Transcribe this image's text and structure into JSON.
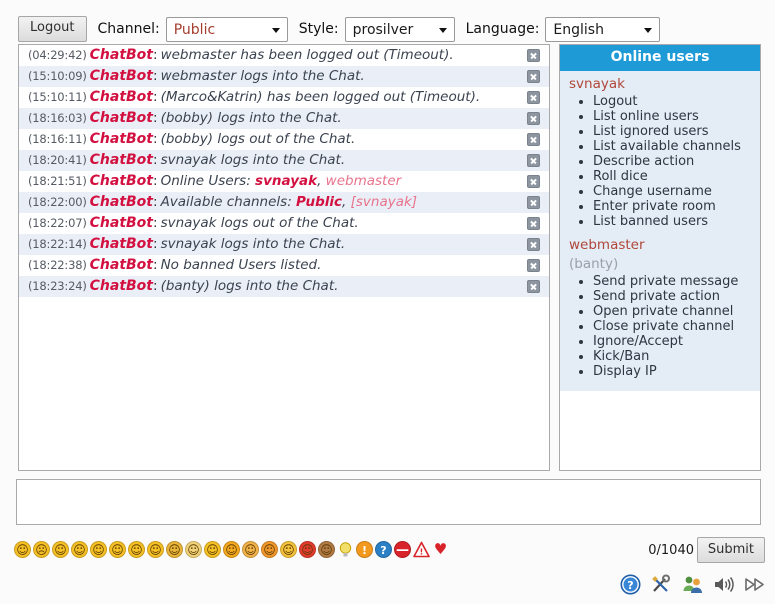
{
  "toolbar": {
    "logout_label": "Logout",
    "channel_label": "Channel:",
    "channel_value": "Public",
    "style_label": "Style:",
    "style_value": "prosilver",
    "language_label": "Language:",
    "language_value": "English"
  },
  "chat": {
    "messages": [
      {
        "time": "(04:29:42)",
        "nick": "ChatBot",
        "text": "webmaster has been logged out (Timeout).",
        "close": "close-icon"
      },
      {
        "time": "(15:10:09)",
        "nick": "ChatBot",
        "text": "webmaster logs into the Chat.",
        "close": "close-icon"
      },
      {
        "time": "(15:10:11)",
        "nick": "ChatBot",
        "text": "(Marco&Katrin) has been logged out (Timeout).",
        "close": "close-icon"
      },
      {
        "time": "(18:16:03)",
        "nick": "ChatBot",
        "text": "(bobby) logs into the Chat.",
        "close": "close-icon"
      },
      {
        "time": "(18:16:11)",
        "nick": "ChatBot",
        "text": "(bobby) logs out of the Chat.",
        "close": "close-icon"
      },
      {
        "time": "(18:20:41)",
        "nick": "ChatBot",
        "text": "svnayak logs into the Chat.",
        "close": "close-icon"
      },
      {
        "time": "(18:21:51)",
        "nick": "ChatBot",
        "text": "Online Users: svnayak, webmaster",
        "close": "close-icon",
        "rich": [
          {
            "t": "Online Users: ",
            "s": "plain"
          },
          {
            "t": "svnayak",
            "s": "hl"
          },
          {
            "t": ", ",
            "s": "plain"
          },
          {
            "t": "webmaster",
            "s": "soft"
          }
        ]
      },
      {
        "time": "(18:22:00)",
        "nick": "ChatBot",
        "text": "Available channels: Public, [svnayak]",
        "close": "close-icon",
        "rich": [
          {
            "t": "Available channels: ",
            "s": "plain"
          },
          {
            "t": "Public",
            "s": "hl"
          },
          {
            "t": ", ",
            "s": "plain"
          },
          {
            "t": "[svnayak]",
            "s": "soft"
          }
        ]
      },
      {
        "time": "(18:22:07)",
        "nick": "ChatBot",
        "text": "svnayak logs out of the Chat.",
        "close": "close-icon"
      },
      {
        "time": "(18:22:14)",
        "nick": "ChatBot",
        "text": "svnayak logs into the Chat.",
        "close": "close-icon"
      },
      {
        "time": "(18:22:38)",
        "nick": "ChatBot",
        "text": "No banned Users listed.",
        "close": "close-icon"
      },
      {
        "time": "(18:23:24)",
        "nick": "ChatBot",
        "text": "(banty) logs into the Chat.",
        "close": "close-icon"
      }
    ]
  },
  "online_users": {
    "title": "Online users",
    "header_color": "#1e9bd7",
    "groups": [
      {
        "name": "svnayak",
        "muted": false,
        "commands": [
          "Logout",
          "List online users",
          "List ignored users",
          "List available channels",
          "Describe action",
          "Roll dice",
          "Change username",
          "Enter private room",
          "List banned users"
        ]
      },
      {
        "name": "webmaster",
        "muted": false,
        "commands": []
      },
      {
        "name": "(banty)",
        "muted": true,
        "commands": [
          "Send private message",
          "Send private action",
          "Open private channel",
          "Close private channel",
          "Ignore/Accept",
          "Kick/Ban",
          "Display IP"
        ]
      }
    ]
  },
  "input": {
    "value": "",
    "placeholder": ""
  },
  "footer": {
    "counter": "0/1040",
    "submit_label": "Submit",
    "emoticons": [
      {
        "name": "smile-emoticon",
        "glyph": "☺",
        "color": "#f5c026"
      },
      {
        "name": "sad-emoticon",
        "glyph": "☹",
        "color": "#f5c026"
      },
      {
        "name": "wink-emoticon",
        "glyph": "☺",
        "color": "#f5c026"
      },
      {
        "name": "tongue-emoticon",
        "glyph": "☺",
        "color": "#f5c026"
      },
      {
        "name": "grin-emoticon",
        "glyph": "☺",
        "color": "#f5c026"
      },
      {
        "name": "neutral-emoticon",
        "glyph": "☺",
        "color": "#f5c026"
      },
      {
        "name": "surprised-emoticon",
        "glyph": "☺",
        "color": "#f5c026"
      },
      {
        "name": "shy-emoticon",
        "glyph": "☺",
        "color": "#f5c026"
      },
      {
        "name": "cool-glasses-emoticon",
        "glyph": "☺",
        "color": "#e8b43a"
      },
      {
        "name": "eyes-wide-emoticon",
        "glyph": "☺",
        "color": "#f0d27a"
      },
      {
        "name": "sunglasses-emoticon",
        "glyph": "☺",
        "color": "#f5c026"
      },
      {
        "name": "laugh-emoticon",
        "glyph": "☺",
        "color": "#f3a81e"
      },
      {
        "name": "cry-emoticon",
        "glyph": "☺",
        "color": "#f1b24a"
      },
      {
        "name": "tongue-out-emoticon",
        "glyph": "☺",
        "color": "#f0962a"
      },
      {
        "name": "blush-emoticon",
        "glyph": "☺",
        "color": "#f3c23a"
      },
      {
        "name": "devil-emoticon",
        "glyph": "☺",
        "color": "#e23b2e"
      },
      {
        "name": "monkey-emoticon",
        "glyph": "☺",
        "color": "#b07a44"
      },
      {
        "name": "idea-bulb-icon",
        "glyph": "●",
        "color": "#f2de6a"
      },
      {
        "name": "exclamation-icon",
        "glyph": "!",
        "color": "#f39a1e"
      },
      {
        "name": "question-icon",
        "glyph": "?",
        "color": "#2b7fc4"
      },
      {
        "name": "forbidden-icon",
        "glyph": "—",
        "color": "#d8232a"
      },
      {
        "name": "warning-icon",
        "glyph": "!",
        "color": "#d8232a"
      },
      {
        "name": "heart-icon",
        "glyph": "♥",
        "color": "#d8232a"
      }
    ],
    "tool_icons": [
      {
        "name": "help-icon",
        "title": "Help"
      },
      {
        "name": "settings-tools-icon",
        "title": "Settings"
      },
      {
        "name": "users-icon",
        "title": "Users"
      },
      {
        "name": "sound-icon",
        "title": "Sound"
      },
      {
        "name": "fast-forward-icon",
        "title": "Fast forward"
      }
    ]
  }
}
